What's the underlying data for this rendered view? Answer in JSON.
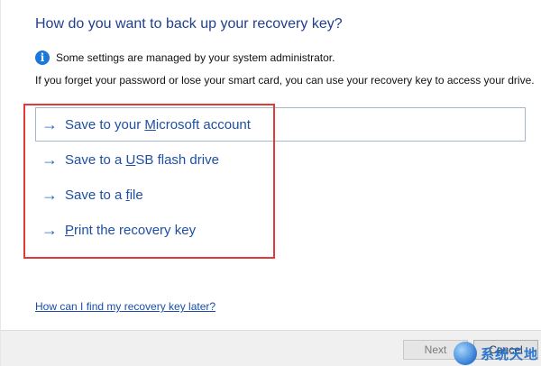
{
  "dialog": {
    "title": "How do you want to back up your recovery key?",
    "info_icon": "info-icon",
    "info_text": "Some settings are managed by your system administrator.",
    "description": "If you forget your password or lose your smart card, you can use your recovery key to access your drive."
  },
  "options": [
    {
      "icon": "arrow-right-icon",
      "pre": "Save to your ",
      "mnemonic": "M",
      "post": "icrosoft account"
    },
    {
      "icon": "arrow-right-icon",
      "pre": "Save to a ",
      "mnemonic": "U",
      "post": "SB flash drive"
    },
    {
      "icon": "arrow-right-icon",
      "pre": "Save to a ",
      "mnemonic": "f",
      "post": "ile"
    },
    {
      "icon": "arrow-right-icon",
      "pre": "",
      "mnemonic": "P",
      "post": "rint the recovery key"
    }
  ],
  "help_link": "How can I find my recovery key later?",
  "footer": {
    "next_label": "Next",
    "cancel_label": "Cancel"
  },
  "watermark": {
    "text": "系统天地"
  },
  "colors": {
    "title": "#1f3f8f",
    "link": "#1f4fa3",
    "highlight": "#e23a3a",
    "info": "#1979d8"
  }
}
